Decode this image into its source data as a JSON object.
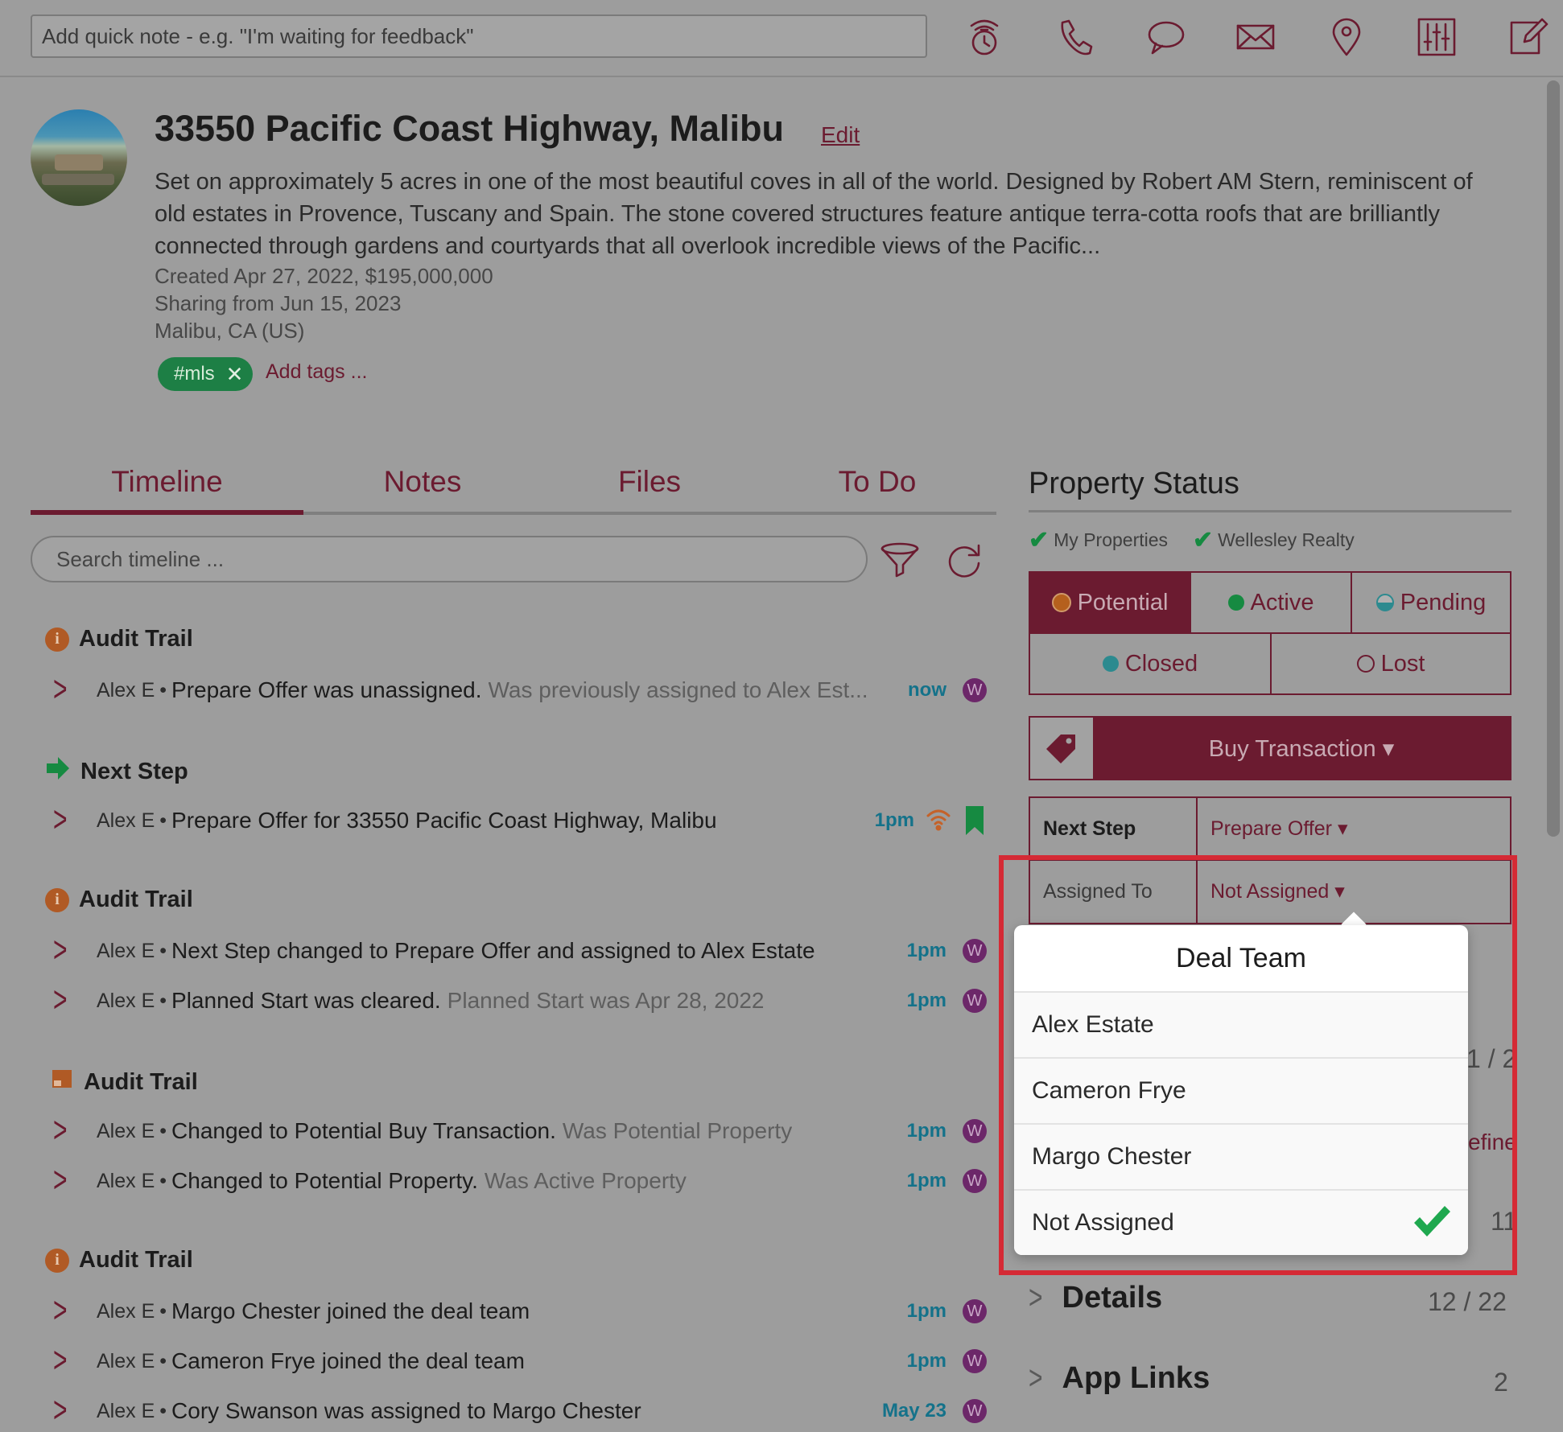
{
  "topbar": {
    "quick_note_placeholder": "Add quick note - e.g. \"I'm waiting for feedback\"",
    "icons": [
      "timer-icon",
      "phone-icon",
      "chat-icon",
      "mail-icon",
      "location-pin-icon",
      "sliders-icon",
      "compose-icon"
    ]
  },
  "property": {
    "title": "33550 Pacific Coast Highway, Malibu",
    "edit_label": "Edit",
    "description": "Set on approximately 5 acres in one of the most beautiful coves in all of the world. Designed by Robert AM Stern, reminiscent of old estates in Provence, Tuscany and Spain. The stone covered structures feature antique terra-cotta roofs that are brilliantly connected through gardens and courtyards that all overlook incredible views of the Pacific...",
    "created": "Created Apr 27, 2022, $195,000,000",
    "sharing": "Sharing from Jun 15, 2023",
    "location": "Malibu, CA (US)",
    "tag": "#mls",
    "tag_remove": "✕",
    "add_tags": "Add tags ..."
  },
  "tabs": [
    {
      "label": "Timeline",
      "active": true
    },
    {
      "label": "Notes"
    },
    {
      "label": "Files"
    },
    {
      "label": "To Do"
    }
  ],
  "timeline": {
    "search_placeholder": "Search timeline ...",
    "groups": [
      {
        "title": "Audit Trail",
        "icon": "info-icon",
        "rows": [
          {
            "who": "Alex E",
            "text": "Prepare Offer was unassigned.",
            "extra": "Was previously assigned to Alex Est...",
            "time": "now",
            "badge": "W"
          }
        ]
      },
      {
        "title": "Next Step",
        "icon": "arrow-right-icon",
        "rows": [
          {
            "who": "Alex E",
            "text": "Prepare Offer for 33550 Pacific Coast Highway, Malibu",
            "extra": "",
            "time": "1pm",
            "badge": ""
          }
        ]
      },
      {
        "title": "Audit Trail",
        "icon": "info-icon",
        "rows": [
          {
            "who": "Alex E",
            "text": "Next Step changed to Prepare Offer and assigned to Alex Estate",
            "extra": "",
            "time": "1pm",
            "badge": "W"
          },
          {
            "who": "Alex E",
            "text": "Planned Start was cleared.",
            "extra": "Planned Start was Apr 28, 2022",
            "time": "1pm",
            "badge": "W"
          }
        ]
      },
      {
        "title": "Audit Trail",
        "icon": "transaction-icon",
        "rows": [
          {
            "who": "Alex E",
            "text": "Changed to Potential Buy Transaction.",
            "extra": "Was Potential Property",
            "time": "1pm",
            "badge": "W"
          },
          {
            "who": "Alex E",
            "text": "Changed to Potential Property.",
            "extra": "Was Active Property",
            "time": "1pm",
            "badge": "W"
          }
        ]
      },
      {
        "title": "Audit Trail",
        "icon": "info-icon",
        "rows": [
          {
            "who": "Alex E",
            "text": "Margo Chester joined the deal team",
            "extra": "",
            "time": "1pm",
            "badge": "W"
          },
          {
            "who": "Alex E",
            "text": "Cameron Frye joined the deal team",
            "extra": "",
            "time": "1pm",
            "badge": "W"
          },
          {
            "who": "Alex E",
            "text": "Cory Swanson was assigned to Margo Chester",
            "extra": "",
            "time": "May 23",
            "badge": "W"
          }
        ]
      }
    ]
  },
  "status_panel": {
    "title": "Property Status",
    "filters": [
      "My Properties",
      "Wellesley Realty"
    ],
    "statuses": [
      {
        "label": "Potential",
        "color": "#b5601d",
        "selected": true
      },
      {
        "label": "Active",
        "color": "#168a41"
      },
      {
        "label": "Pending",
        "color": "#2c8a8f"
      },
      {
        "label": "Closed",
        "color": "#2c8a8f"
      },
      {
        "label": "Lost",
        "color": "transparent"
      }
    ],
    "transaction_label": "Buy Transaction ▾",
    "next_step_key": "Next Step",
    "next_step_value": "Prepare Offer ▾",
    "assigned_key": "Assigned To",
    "assigned_value": "Not Assigned ▾",
    "peek_ratio": "1 / 2",
    "peek_define": "efine",
    "peek_count": "11"
  },
  "popover": {
    "title": "Deal Team",
    "items": [
      {
        "label": "Alex Estate",
        "checked": false
      },
      {
        "label": "Cameron Frye",
        "checked": false
      },
      {
        "label": "Margo Chester",
        "checked": false
      },
      {
        "label": "Not Assigned",
        "checked": true
      }
    ]
  },
  "sections": [
    {
      "label": "Details",
      "count": "12 / 22"
    },
    {
      "label": "App Links",
      "count": "2"
    }
  ],
  "colors": {
    "brand": "#6b1b30",
    "accent_green": "#168a41",
    "time_teal": "#14728a",
    "highlight": "#d52a35"
  }
}
